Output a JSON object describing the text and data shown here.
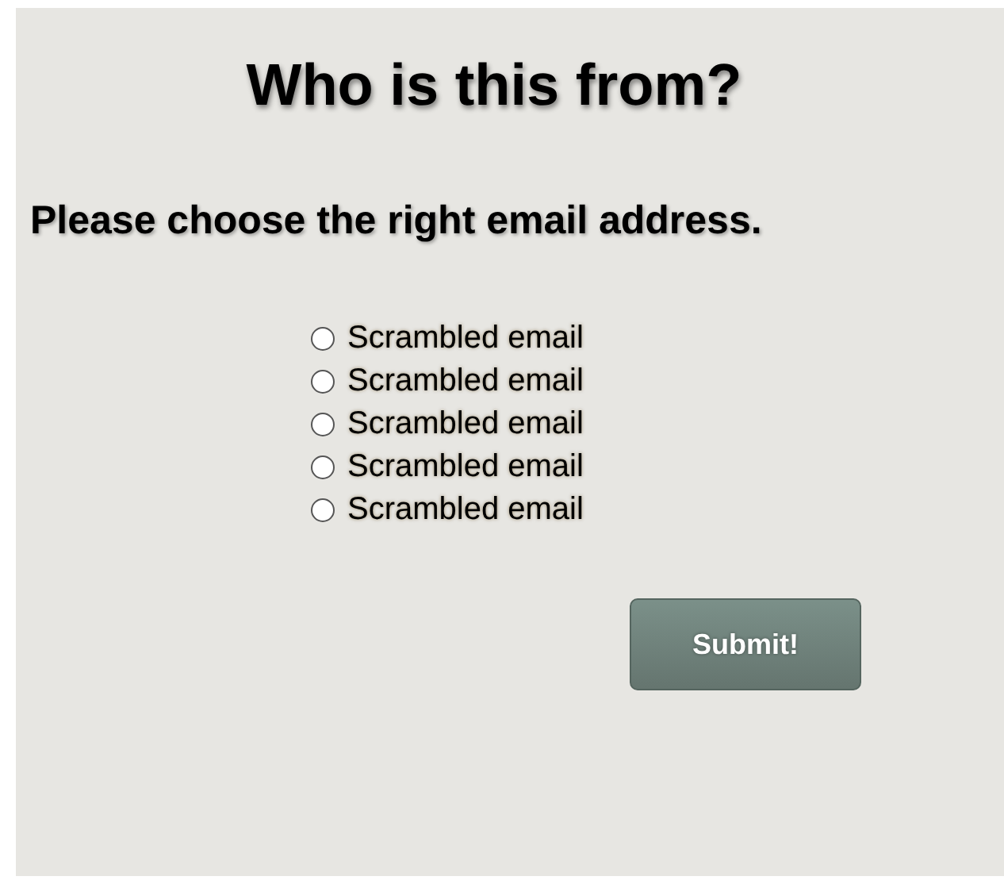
{
  "title": "Who is this from?",
  "prompt": "Please choose the right email address.",
  "options": [
    {
      "label": "Scrambled email",
      "selected": false
    },
    {
      "label": "Scrambled email",
      "selected": false
    },
    {
      "label": "Scrambled email",
      "selected": false
    },
    {
      "label": "Scrambled email",
      "selected": false
    },
    {
      "label": "Scrambled email",
      "selected": false
    }
  ],
  "submit": "Submit!"
}
